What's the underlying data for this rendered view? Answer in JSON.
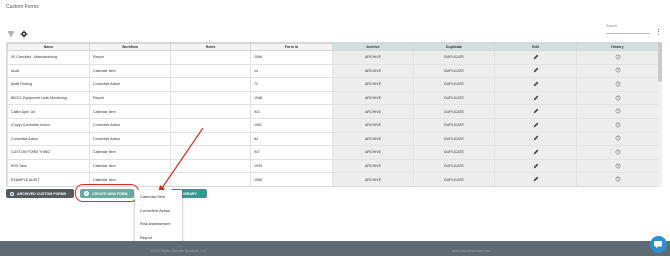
{
  "page": {
    "title": "Custom Forms"
  },
  "search": {
    "label": "Search"
  },
  "table": {
    "columns": [
      "Name",
      "Workflow",
      "Roles",
      "Form Id",
      "Archive",
      "Duplicate",
      "Edit",
      "History"
    ],
    "rows": [
      {
        "name": "5S Checklist - Manufacturing",
        "workflow": "Report",
        "roles": "",
        "form_id": "2066",
        "archive": "ARCHIVE",
        "duplicate": "DUPLICATE"
      },
      {
        "name": "Audit",
        "workflow": "Calendar Item",
        "roles": "",
        "form_id": "14",
        "archive": "ARCHIVE",
        "duplicate": "DUPLICATE"
      },
      {
        "name": "Audit Finding",
        "workflow": "Corrective Action",
        "roles": "",
        "form_id": "72",
        "archive": "ARCHIVE",
        "duplicate": "DUPLICATE"
      },
      {
        "name": "BB/CC Equipment Leak Monitoring",
        "workflow": "Report",
        "roles": "",
        "form_id": "1948",
        "archive": "ARCHIVE",
        "duplicate": "DUPLICATE"
      },
      {
        "name": "Caitlin April 1st",
        "workflow": "Calendar Item",
        "roles": "",
        "form_id": "931",
        "archive": "ARCHIVE",
        "duplicate": "DUPLICATE"
      },
      {
        "name": "(Copy) Corrective Action",
        "workflow": "Corrective Action",
        "roles": "",
        "form_id": "1981",
        "archive": "ARCHIVE",
        "duplicate": "DUPLICATE"
      },
      {
        "name": "Corrective Action",
        "workflow": "Corrective Action",
        "roles": "",
        "form_id": "84",
        "archive": "ARCHIVE",
        "duplicate": "DUPLICATE"
      },
      {
        "name": "CUSTOM FORM THING",
        "workflow": "Calendar Item",
        "roles": "",
        "form_id": "947",
        "archive": "ARCHIVE",
        "duplicate": "DUPLICATE"
      },
      {
        "name": "EHS Task",
        "workflow": "Calendar Item",
        "roles": "",
        "form_id": "1930",
        "archive": "ARCHIVE",
        "duplicate": "DUPLICATE"
      },
      {
        "name": "EXAMPLE AUDIT",
        "workflow": "Calendar Item",
        "roles": "",
        "form_id": "1985",
        "archive": "ARCHIVE",
        "duplicate": "DUPLICATE"
      }
    ]
  },
  "buttons": {
    "archived": "ARCHIVED CUSTOM FORMS",
    "create": "CREATE NEW FORM",
    "library": "LIBRARY"
  },
  "dropdown": {
    "items": [
      "Calendar Item",
      "Corrective Action",
      "Risk Assessment",
      "Report"
    ]
  },
  "footer": {
    "left": "©2025 Rights Gensuite Solutions, LLC",
    "right": "www.ehscoreservices.com"
  },
  "colors": {
    "accent": "#2d9c93",
    "create_button": "#6aa9a4",
    "highlight": "#e02a1f",
    "footer": "#5f6b73"
  },
  "icons": [
    "filter-icon",
    "gear-icon",
    "kebab-menu-icon",
    "pencil-icon",
    "history-icon",
    "plus-icon",
    "chat-icon"
  ]
}
